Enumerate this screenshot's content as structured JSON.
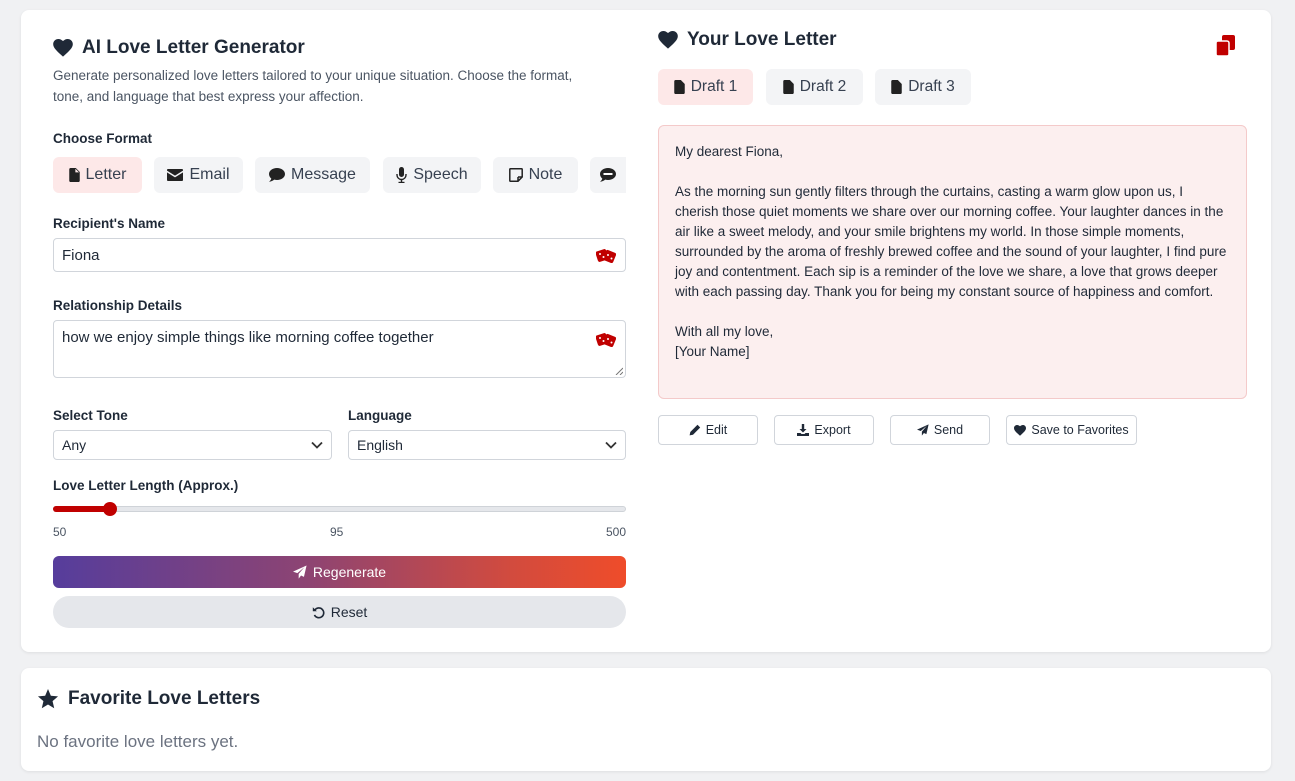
{
  "generator": {
    "title": "AI Love Letter Generator",
    "description_line1": "Generate personalized love letters tailored to your unique situation. Choose the format,",
    "description_line2": "tone, and language that best express your affection.",
    "format_label": "Choose Format",
    "formats": [
      {
        "label": "Letter",
        "icon": "file-icon",
        "active": true
      },
      {
        "label": "Email",
        "icon": "envelope-icon",
        "active": false
      },
      {
        "label": "Message",
        "icon": "comment-icon",
        "active": false
      },
      {
        "label": "Speech",
        "icon": "microphone-icon",
        "active": false
      },
      {
        "label": "Note",
        "icon": "note-icon",
        "active": false
      },
      {
        "label": "",
        "icon": "sms-icon",
        "active": false
      }
    ],
    "recipient_label": "Recipient's Name",
    "recipient_value": "Fiona",
    "relationship_label": "Relationship Details",
    "relationship_value": "how we enjoy simple things like morning coffee together",
    "tone_label": "Select Tone",
    "tone_value": "Any",
    "language_label": "Language",
    "language_value": "English",
    "length_label": "Love Letter Length (Approx.)",
    "length_min": "50",
    "length_current": "95",
    "length_max": "500",
    "length_fraction": 0.1,
    "regenerate_label": "Regenerate",
    "reset_label": "Reset"
  },
  "letter": {
    "title": "Your Love Letter",
    "drafts": [
      {
        "label": "Draft 1",
        "active": true
      },
      {
        "label": "Draft 2",
        "active": false
      },
      {
        "label": "Draft 3",
        "active": false
      }
    ],
    "greeting": "My dearest Fiona,",
    "body": "As the morning sun gently filters through the curtains, casting a warm glow upon us, I cherish those quiet moments we share over our morning coffee. Your laughter dances in the air like a sweet melody, and your smile brightens my world. In those simple moments, surrounded by the aroma of freshly brewed coffee and the sound of your laughter, I find pure joy and contentment. Each sip is a reminder of the love we share, a love that grows deeper with each passing day. Thank you for being my constant source of happiness and comfort.",
    "closing": "With all my love,",
    "signature": "[Your Name]",
    "actions": {
      "edit": "Edit",
      "export": "Export",
      "send": "Send",
      "save": "Save to Favorites"
    }
  },
  "favorites": {
    "title": "Favorite Love Letters",
    "empty": "No favorite love letters yet."
  },
  "colors": {
    "accent": "#c00000",
    "active_chip": "#fde8e8",
    "letter_bg": "#fcefef"
  }
}
